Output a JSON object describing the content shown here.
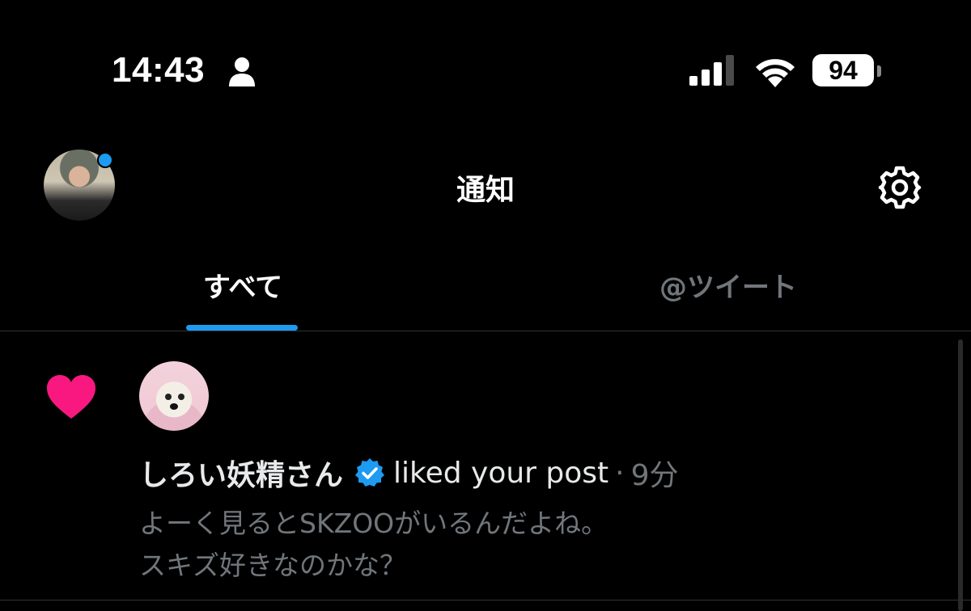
{
  "status_bar": {
    "time": "14:43",
    "battery_level": "94",
    "icons": [
      "person-icon",
      "signal-icon",
      "wifi-icon",
      "battery-icon"
    ]
  },
  "header": {
    "title": "通知",
    "avatar_badge_color": "#1d9bf0",
    "icons": [
      "avatar",
      "gear-icon"
    ]
  },
  "tabs": [
    {
      "label": "すべて",
      "active": true
    },
    {
      "label": "@ツイート",
      "active": false
    }
  ],
  "colors": {
    "accent": "#1d9bf0",
    "like": "#f91880",
    "muted_text": "#71767b",
    "background": "#000000"
  },
  "notification": {
    "type_icon": "heart-icon",
    "user_name": "しろい妖精さん",
    "verified": true,
    "action": "liked your post",
    "separator": "·",
    "time_ago": "9分",
    "post_lines": [
      "よーく見るとSKZOOがいるんだよね。",
      "スキズ好きなのかな？"
    ]
  }
}
